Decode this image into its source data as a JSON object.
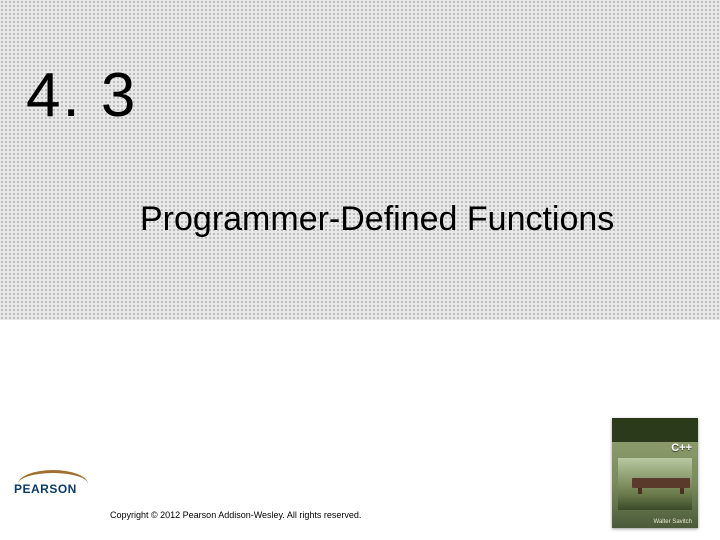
{
  "section": {
    "number": "4. 3",
    "title": "Programmer-Defined Functions"
  },
  "publisher": {
    "name": "PEARSON"
  },
  "copyright": "Copyright © 2012 Pearson Addison-Wesley. All rights reserved.",
  "book": {
    "lang": "C++",
    "author": "Walter Savitch"
  }
}
